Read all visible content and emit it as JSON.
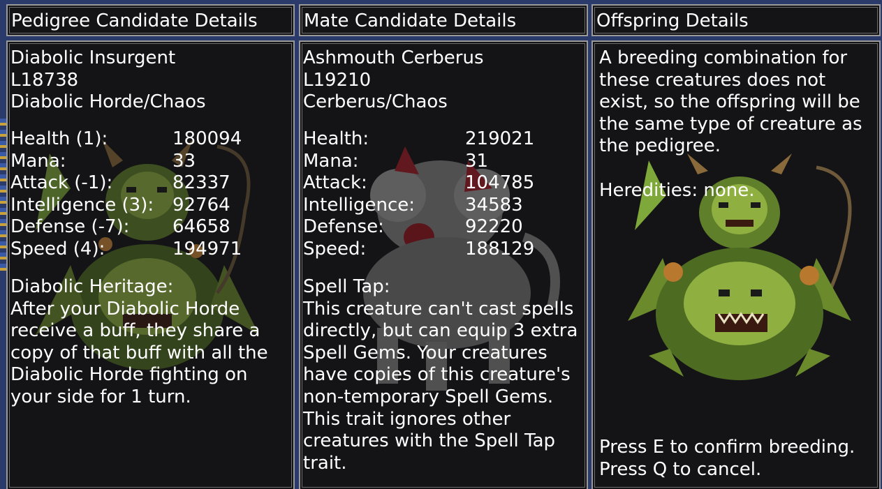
{
  "panels": {
    "pedigree": {
      "title": "Pedigree Candidate Details",
      "name": "Diabolic Insurgent",
      "level": "L18738",
      "type": "Diabolic Horde/Chaos",
      "stats": [
        {
          "label": "Health (1):",
          "value": "180094"
        },
        {
          "label": "Mana:",
          "value": "33"
        },
        {
          "label": "Attack (-1):",
          "value": "82337"
        },
        {
          "label": "Intelligence (3):",
          "value": "92764"
        },
        {
          "label": "Defense (-7):",
          "value": "64658"
        },
        {
          "label": "Speed (4):",
          "value": "194971"
        }
      ],
      "trait_name": "Diabolic Heritage:",
      "trait_lines": [
        "After your Diabolic Horde",
        "receive a buff, they share a",
        "copy of that buff with all the",
        "Diabolic Horde fighting on",
        "your side for 1 turn."
      ]
    },
    "mate": {
      "title": "Mate Candidate Details",
      "name": "Ashmouth Cerberus",
      "level": "L19210",
      "type": "Cerberus/Chaos",
      "stats": [
        {
          "label": "Health:",
          "value": "219021"
        },
        {
          "label": "Mana:",
          "value": "31"
        },
        {
          "label": "Attack:",
          "value": "104785"
        },
        {
          "label": "Intelligence:",
          "value": "34583"
        },
        {
          "label": "Defense:",
          "value": "92220"
        },
        {
          "label": "Speed:",
          "value": "188129"
        }
      ],
      "trait_name": "Spell Tap:",
      "trait_lines": [
        "This creature can't cast spells",
        "directly, but can equip 3 extra",
        "Spell Gems. Your creatures",
        "have copies of this creature's",
        "non-temporary Spell Gems.",
        "This trait ignores other",
        "creatures with the Spell Tap",
        "trait."
      ]
    },
    "offspring": {
      "title": "Offspring Details",
      "info_lines": [
        "A breeding combination for",
        "these creatures does not",
        "exist, so the offspring will be",
        "the same type of creature as",
        "the pedigree."
      ],
      "heredities": "Heredities: none.",
      "confirm_hint": "Press E to confirm breeding.",
      "cancel_hint": "Press Q to cancel."
    }
  }
}
